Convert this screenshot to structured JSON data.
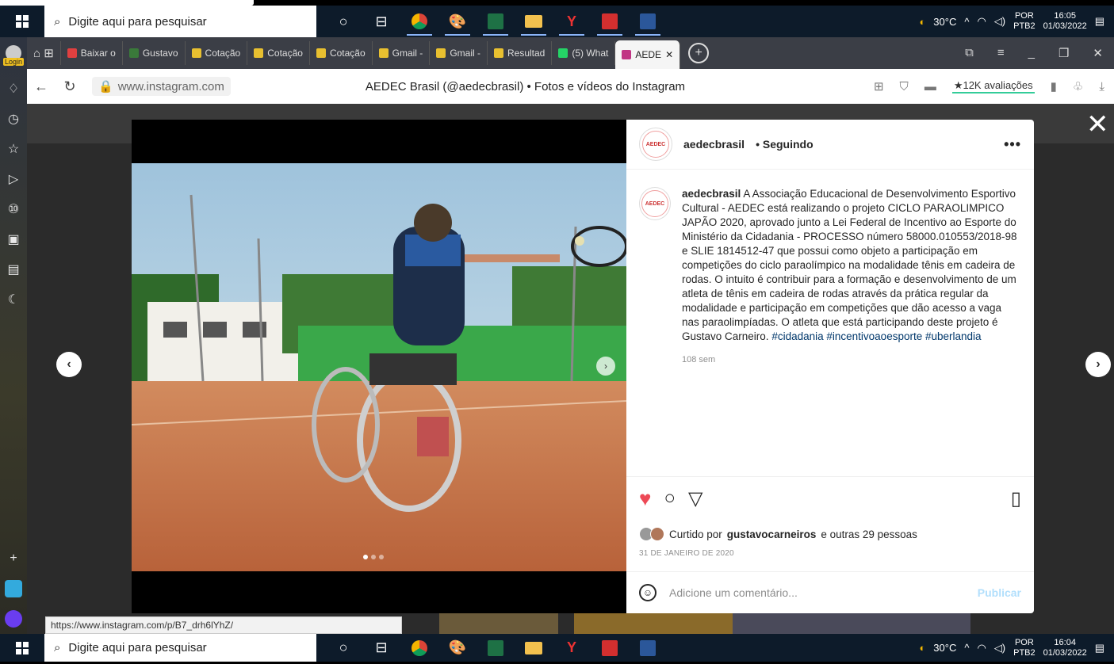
{
  "taskbar": {
    "search_placeholder": "Digite aqui para pesquisar",
    "apps": [
      "cortana-icon",
      "taskview-icon",
      "chrome-icon",
      "paint-icon",
      "excel-icon",
      "explorer-icon",
      "yandex-icon",
      "acrobat-icon",
      "word-icon"
    ],
    "weather": "30°C",
    "lang_top": "POR",
    "lang_bottom": "PTB2",
    "top_time": "16:05",
    "top_date": "01/03/2022",
    "bottom_time": "16:04",
    "bottom_date": "01/03/2022"
  },
  "sidebar": {
    "login_label": "Login"
  },
  "tabs": [
    {
      "label": "Baixar o",
      "color": "#e04040"
    },
    {
      "label": "Gustavo",
      "color": "#3a7a3a"
    },
    {
      "label": "Cotação",
      "color": "#e8c030"
    },
    {
      "label": "Cotação",
      "color": "#e8c030"
    },
    {
      "label": "Cotação",
      "color": "#e8c030"
    },
    {
      "label": "Gmail -",
      "color": "#e8c030"
    },
    {
      "label": "Gmail -",
      "color": "#e8c030"
    },
    {
      "label": "Resultad",
      "color": "#e8c030"
    },
    {
      "label": "(5) What",
      "color": "#25d366"
    },
    {
      "label": "AEDE",
      "color": "#c13584",
      "active": true
    }
  ],
  "address": {
    "url": "www.instagram.com",
    "title": "AEDEC Brasil (@aedecbrasil) • Fotos e vídeos do Instagram",
    "rating": "★12K avaliações"
  },
  "status_url": "https://www.instagram.com/p/B7_drh6lYhZ/",
  "post": {
    "username": "aedecbrasil",
    "follow_status": "• Seguindo",
    "more": "•••",
    "avatar_text": "AEDEC",
    "caption_user": "aedecbrasil",
    "caption": "A Associação Educacional de Desenvolvimento Esportivo Cultural - AEDEC está realizando o projeto CICLO PARAOLIMPICO JAPÃO 2020, aprovado junto a Lei Federal de Incentivo ao Esporte do Ministério da Cidadania - PROCESSO número 58000.010553/2018-98 e SLIE 1814512-47 que possui como objeto a participação em competições do ciclo paraolímpico na modalidade tênis em cadeira de rodas. O intuito é contribuir para a formação e desenvolvimento de um atleta de tênis em cadeira de rodas através da prática regular da modalidade e participação em competições que dão acesso a vaga nas paraolimpíadas. O atleta que está participando deste projeto é Gustavo Carneiro.",
    "hashtags": "#cidadania #incentivoaoesporte #uberlandia",
    "caption_time": "108 sem",
    "liked_prefix": "Curtido por",
    "liked_user": "gustavocarneiros",
    "liked_suffix": "e outras 29 pessoas",
    "date": "31 DE JANEIRO DE 2020",
    "comment_placeholder": "Adicione um comentário...",
    "publish_label": "Publicar"
  }
}
